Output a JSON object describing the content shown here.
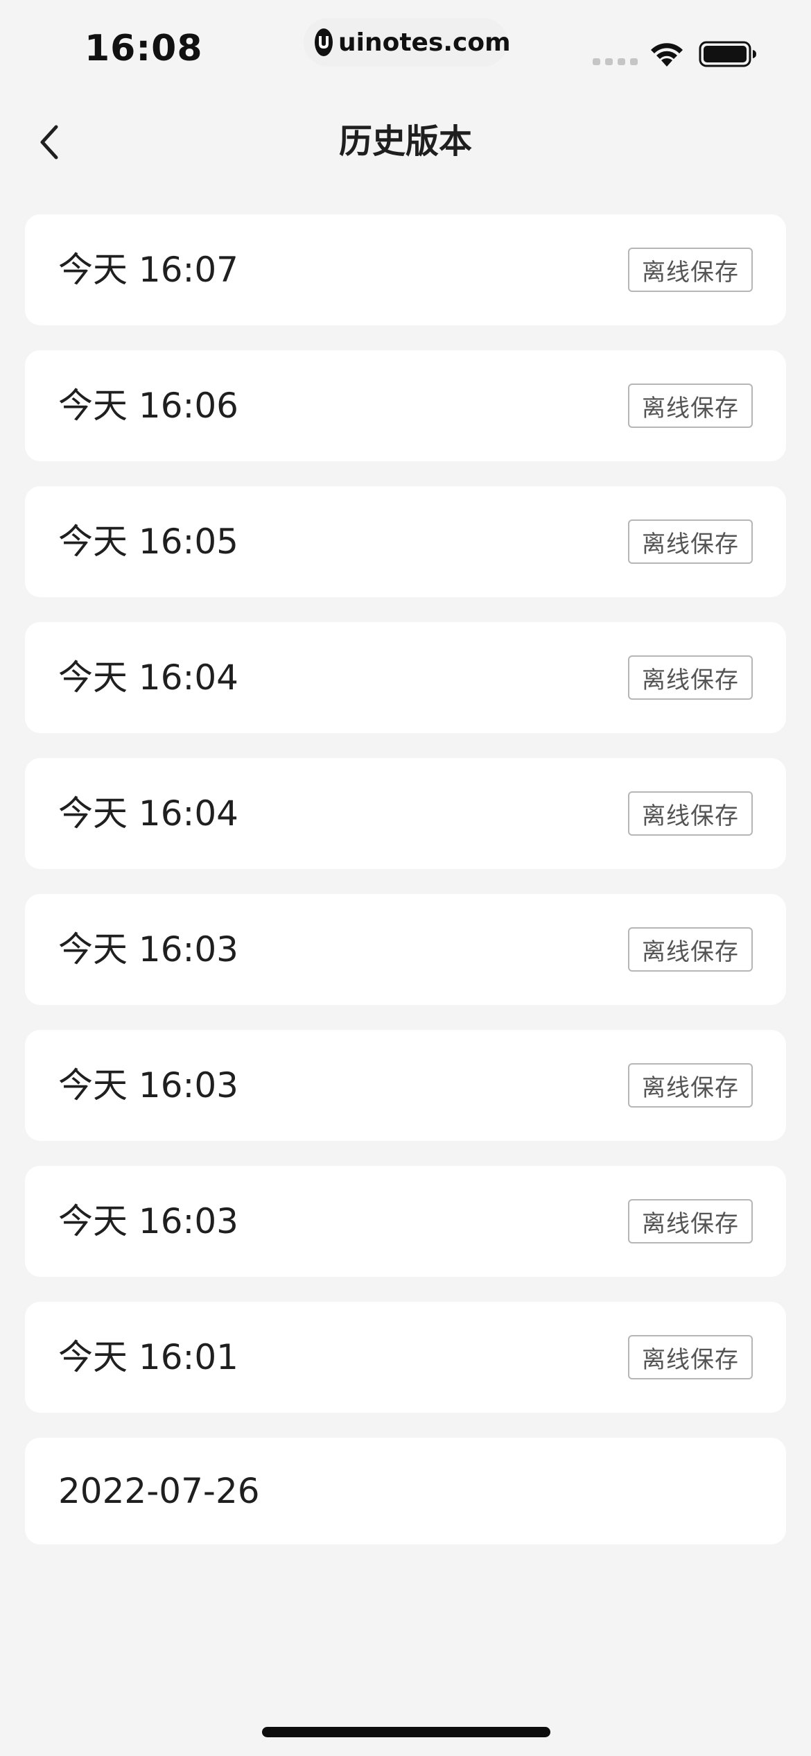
{
  "status_bar": {
    "time": "16:08",
    "site": "uinotes.com"
  },
  "nav": {
    "title": "历史版本",
    "back_icon": "chevron-left-icon"
  },
  "versions": [
    {
      "label": "今天 16:07",
      "badge": "离线保存"
    },
    {
      "label": "今天 16:06",
      "badge": "离线保存"
    },
    {
      "label": "今天 16:05",
      "badge": "离线保存"
    },
    {
      "label": "今天 16:04",
      "badge": "离线保存"
    },
    {
      "label": "今天 16:04",
      "badge": "离线保存"
    },
    {
      "label": "今天 16:03",
      "badge": "离线保存"
    },
    {
      "label": "今天 16:03",
      "badge": "离线保存"
    },
    {
      "label": "今天 16:03",
      "badge": "离线保存"
    },
    {
      "label": "今天 16:01",
      "badge": "离线保存"
    },
    {
      "label": "2022-07-26",
      "badge": null
    }
  ],
  "colors": {
    "background": "#f4f4f4",
    "card": "#ffffff",
    "text": "#1f1f1f",
    "badge_border": "#b6b6b6"
  }
}
